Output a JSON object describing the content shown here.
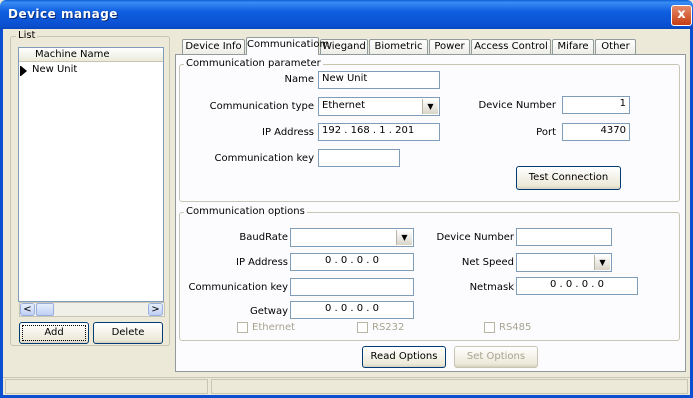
{
  "window": {
    "title": "Device manage",
    "close_glyph": "x"
  },
  "list_panel": {
    "legend": "List",
    "column_header": "Machine Name",
    "rows": [
      {
        "name": "New Unit",
        "selected": true
      }
    ],
    "add_button": "Add",
    "delete_button": "Delete",
    "scroll_left": "<",
    "scroll_right": ">"
  },
  "tabs": [
    {
      "label": "Device Info",
      "active": false
    },
    {
      "label": "Communicatiom",
      "active": true
    },
    {
      "label": "Wiegand",
      "active": false
    },
    {
      "label": "Biometric",
      "active": false
    },
    {
      "label": "Power",
      "active": false
    },
    {
      "label": "Access Control",
      "active": false
    },
    {
      "label": "Mifare",
      "active": false
    },
    {
      "label": "Other",
      "active": false
    }
  ],
  "comm_parameter": {
    "legend": "Communication parameter",
    "name_label": "Name",
    "name_value": "New Unit",
    "comm_type_label": "Communication type",
    "comm_type_value": "Ethernet",
    "ip_label": "IP Address",
    "ip_value": "192 . 168 . 1 . 201",
    "comm_key_label": "Communication key",
    "comm_key_value": "",
    "device_number_label": "Device Number",
    "device_number_value": "1",
    "port_label": "Port",
    "port_value": "4370",
    "test_button": "Test Connection"
  },
  "comm_options": {
    "legend": "Communication options",
    "baudrate_label": "BaudRate",
    "baudrate_value": "",
    "ip_label": "IP Address",
    "ip_value": "0 . 0 . 0 . 0",
    "comm_key_label": "Communication key",
    "comm_key_value": "",
    "gateway_label": "Getway",
    "gateway_value": "0 . 0 . 0 . 0",
    "device_number_label": "Device Number",
    "device_number_value": "",
    "net_speed_label": "Net Speed",
    "net_speed_value": "",
    "netmask_label": "Netmask",
    "netmask_value": "0 . 0 . 0 . 0",
    "check_ethernet": "Ethernet",
    "check_rs232": "RS232",
    "check_rs485": "RS485"
  },
  "bottom_buttons": {
    "read_options": "Read Options",
    "set_options": "Set Options"
  },
  "colors": {
    "titlebar": "#0a4fd0",
    "face": "#ece9d8",
    "border": "#7f9db9"
  }
}
